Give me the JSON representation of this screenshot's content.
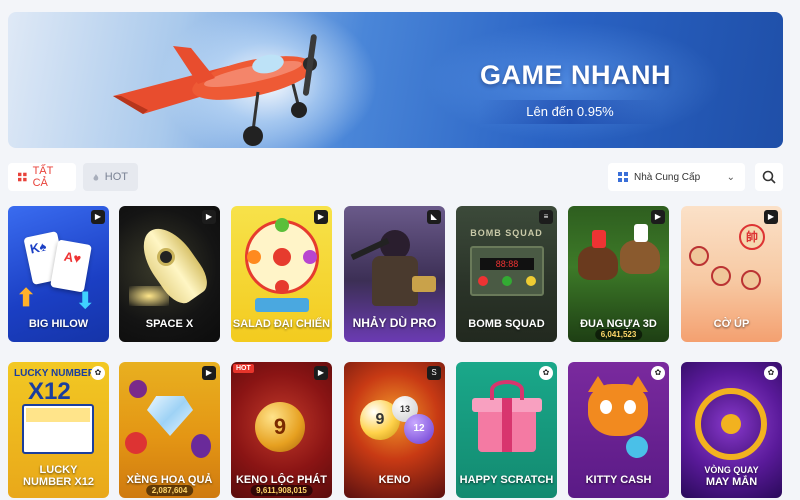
{
  "banner": {
    "title": "GAME NHANH",
    "subtitle": "Lên đến 0.95%"
  },
  "filters": {
    "all_label": "TẤT CẢ",
    "hot_label": "HOT",
    "provider_label": "Nhà Cung Cấp"
  },
  "colors": {
    "accent": "#e8423a",
    "banner_blue": "#2a63c4",
    "page_bg": "#f3f5f9"
  },
  "games": [
    {
      "title": "BIG HILOW",
      "icon": "play-icon"
    },
    {
      "title": "SPACE X",
      "icon": "play-icon"
    },
    {
      "title": "SALAD ĐẠI CHIẾN",
      "icon": "play-icon"
    },
    {
      "title": "NHẢY DÙ PRO",
      "icon": "provider-icon"
    },
    {
      "title": "BOMB SQUAD",
      "icon": "provider-icon"
    },
    {
      "title": "ĐUA NGỰA 3D",
      "jackpot": "6,041,523",
      "icon": "play-icon"
    },
    {
      "title": "CỜ ÚP",
      "icon": "play-icon"
    },
    {
      "title": "LUCKY",
      "title2": "NUMBER X12",
      "badge_text": "LUCKY NUMBER",
      "badge_big": "X12",
      "icon": "paw-icon"
    },
    {
      "title": "XÈNG HOA QUẢ",
      "jackpot": "2,087,604",
      "icon": "play-icon"
    },
    {
      "title": "KENO LỘC PHÁT",
      "jackpot": "9,611,908,015",
      "hot": "HOT",
      "icon": "play-icon"
    },
    {
      "title": "KENO",
      "icon": "provider-icon"
    },
    {
      "title": "HAPPY SCRATCH",
      "icon": "paw-icon"
    },
    {
      "title": "KITTY CASH",
      "icon": "paw-icon"
    },
    {
      "title": "VÒNG QUAY",
      "title2": "MAY MẮN",
      "icon": "paw-icon"
    }
  ]
}
